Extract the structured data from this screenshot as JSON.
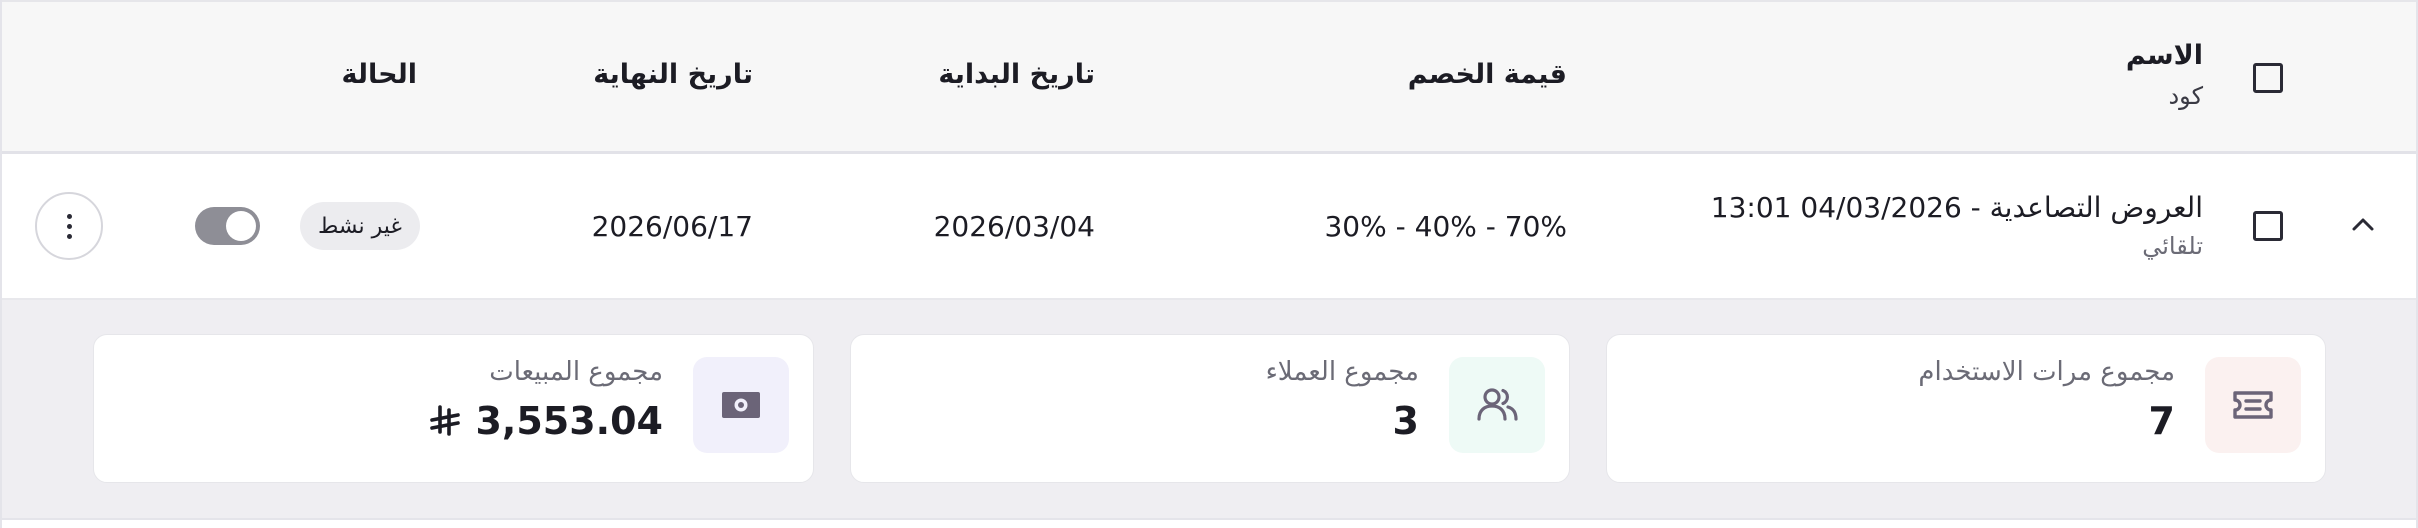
{
  "header": {
    "name_label": "الاسم",
    "code_label": "كود",
    "discount_label": "قيمة الخصم",
    "start_label": "تاريخ البداية",
    "end_label": "تاريخ النهاية",
    "status_label": "الحالة"
  },
  "row": {
    "name": "العروض التصاعدية - 04/03/2026 13:01",
    "code": "تلقائي",
    "discount": "30% - 40% - 70%",
    "start_date": "2026/03/04",
    "end_date": "2026/06/17",
    "status_badge": "غير نشط",
    "toggle_on": true
  },
  "stats": [
    {
      "label": "مجموع مرات الاستخدام",
      "value": "7",
      "icon": "ticket-icon",
      "icon_bg": "#fbf1f0"
    },
    {
      "label": "مجموع العملاء",
      "value": "3",
      "icon": "users-icon",
      "icon_bg": "#eefaf6"
    },
    {
      "label": "مجموع المبيعات",
      "value": "3,553.04",
      "currency_symbol": "riyal-icon",
      "icon": "cash-icon",
      "icon_bg": "#f1f0fb"
    }
  ],
  "colors": {
    "icon": "#6b6478",
    "dark": "#1c1c24",
    "muted": "#6b6b76"
  }
}
